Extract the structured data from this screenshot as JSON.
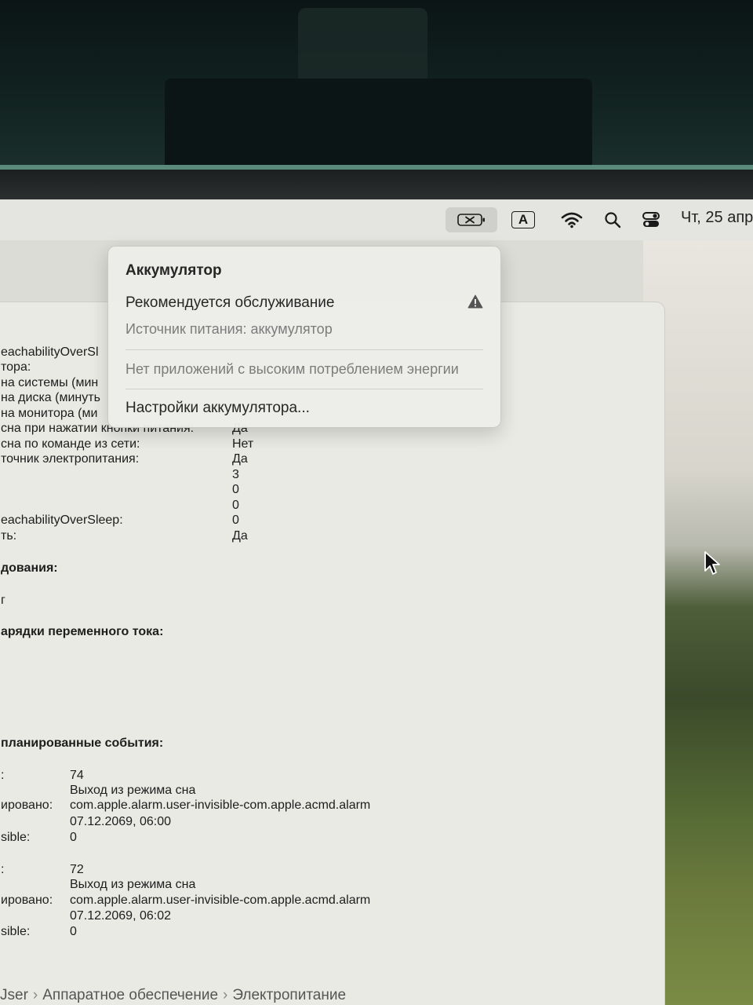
{
  "menubar": {
    "input_source_label": "A",
    "clock": "Чт, 25 апр"
  },
  "battery_menu": {
    "title": "Аккумулятор",
    "service_status": "Рекомендуется обслуживание",
    "power_source": "Источник питания: аккумулятор",
    "no_apps": "Нет приложений с высоким потреблением энергии",
    "settings": "Настройки аккумулятора..."
  },
  "sysinfo": {
    "rows": [
      {
        "label": "eachabilityOverSl",
        "value": ""
      },
      {
        "label": "тора:",
        "value": ""
      },
      {
        "label": "на системы (мин",
        "value": ""
      },
      {
        "label": "на диска (минуть",
        "value": ""
      },
      {
        "label": "на монитора (ми",
        "value": ""
      },
      {
        "label": "сна при нажатии кнопки питания:",
        "value": "Да"
      },
      {
        "label": "сна по команде из сети:",
        "value": "Нет"
      },
      {
        "label": "точник электропитания:",
        "value": "Да"
      },
      {
        "label": "",
        "value": "3"
      },
      {
        "label": "",
        "value": "0"
      },
      {
        "label": "",
        "value": "0"
      },
      {
        "label": "eachabilityOverSleep:",
        "value": "0"
      },
      {
        "label": "ть:",
        "value": "Да"
      }
    ],
    "section_hardware": "дования:",
    "hardware_stub": "г",
    "section_ac": "арядки переменного тока:",
    "section_events": "планированные события:",
    "events": [
      {
        "id_label": ":",
        "id": "74",
        "type": "Выход из режима сна",
        "owner_label": "ировано:",
        "owner": "com.apple.alarm.user-invisible-com.apple.acmd.alarm",
        "time": "07.12.2069, 06:00",
        "visible_label": "sible:",
        "visible": "0"
      },
      {
        "id_label": ":",
        "id": "72",
        "type": "Выход из режима сна",
        "owner_label": "ировано:",
        "owner": "com.apple.alarm.user-invisible-com.apple.acmd.alarm",
        "time": "07.12.2069, 06:02",
        "visible_label": "sible:",
        "visible": "0"
      }
    ],
    "breadcrumb": [
      "Jser",
      "Аппаратное обеспечение",
      "Электропитание"
    ]
  },
  "icons": [
    "battery-icon",
    "input-source-icon",
    "wifi-icon",
    "search-icon",
    "control-center-icon",
    "warning-icon",
    "pointer-cursor-icon"
  ]
}
